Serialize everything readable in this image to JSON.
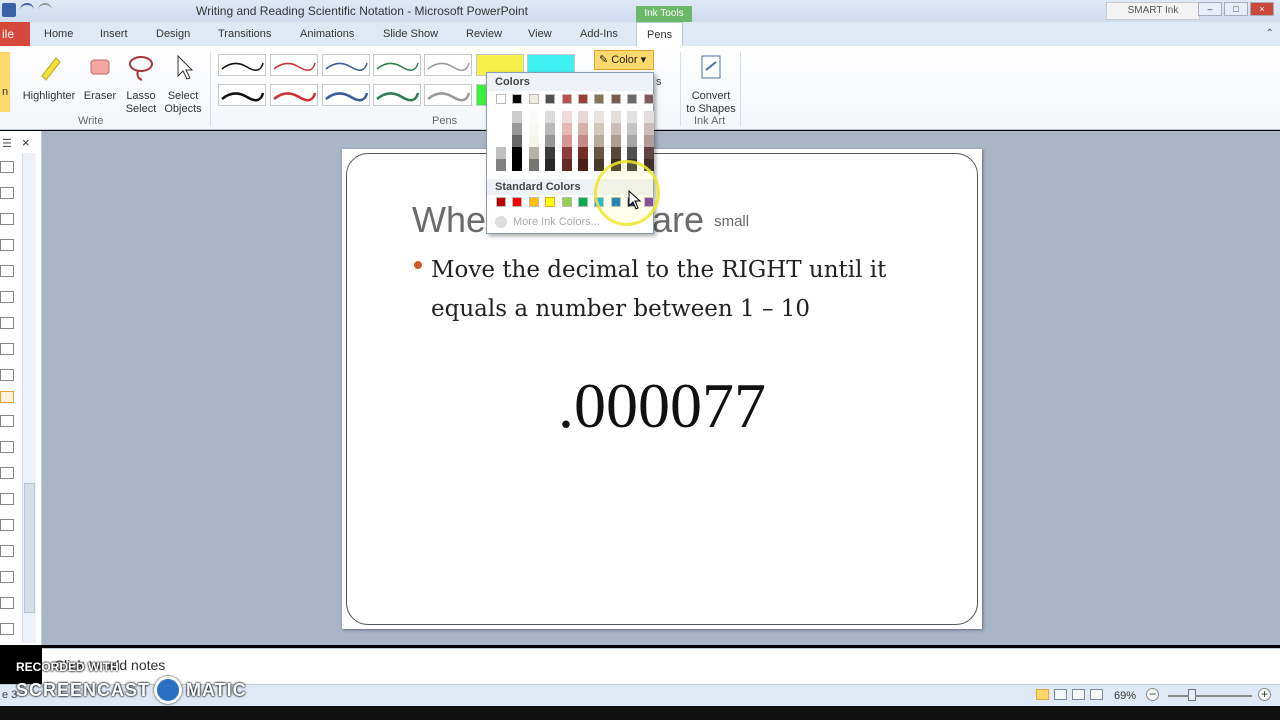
{
  "window": {
    "title": "Writing and Reading Scientific Notation - Microsoft PowerPoint",
    "context_tab": "Ink Tools",
    "smart_ink": "SMART Ink"
  },
  "ribbon_tabs": {
    "file": "ile",
    "home": "Home",
    "insert": "Insert",
    "design": "Design",
    "transitions": "Transitions",
    "animations": "Animations",
    "slideshow": "Slide Show",
    "review": "Review",
    "view": "View",
    "addins": "Add-Ins",
    "pens": "Pens"
  },
  "ribbon": {
    "pen_partial": "n",
    "highlighter": "Highlighter",
    "eraser": "Eraser",
    "lasso_line1": "Lasso",
    "lasso_line2": "Select",
    "select_line1": "Select",
    "select_line2": "Objects",
    "group_write": "Write",
    "group_pens": "Pens",
    "color_button": "Color",
    "convert_line1": "Convert",
    "convert_line2": "to Shapes",
    "group_inkart": "Ink Art",
    "weight_partial": "s"
  },
  "color_dropdown": {
    "heading_theme": "Colors",
    "heading_standard": "Standard Colors",
    "more_colors": "More Ink Colors...",
    "theme_row": [
      "#ffffff",
      "#000000",
      "#eeece1",
      "#4f4f4f",
      "#c0504d",
      "#9b3d30",
      "#8b7355",
      "#7a5c48",
      "#6b6b6b",
      "#7e5b58"
    ],
    "standard_colors": [
      "#c00000",
      "#ff0000",
      "#ffc000",
      "#ffff00",
      "#92d050",
      "#00b050",
      "#00b0f0",
      "#0070c0",
      "#002060",
      "#7030a0"
    ]
  },
  "slide": {
    "title_start": "Whe",
    "title_end": "s are",
    "title_small": "small",
    "bullet": "Move the decimal to the RIGHT until it equals a number between 1 – 10",
    "number": ".000077"
  },
  "notes": {
    "placeholder": "Click to add notes"
  },
  "statusbar": {
    "slide_info": "e 3",
    "zoom": "69%"
  },
  "watermark": {
    "recorded": "RECORDED WITH",
    "brand_left": "SCREENCAST",
    "brand_right": "MATIC"
  }
}
